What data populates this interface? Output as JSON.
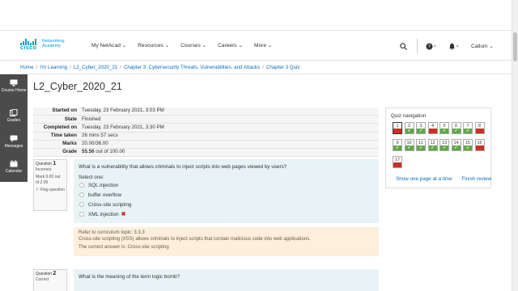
{
  "header": {
    "logo_top": "cisco",
    "logo_right": "Networking Academy",
    "nav": [
      "My NetAcad",
      "Resources",
      "Courses",
      "Careers",
      "More"
    ],
    "user": "Callum"
  },
  "breadcrumb": [
    "Home",
    "I'm Learning",
    "L2_Cyber_2020_21",
    "Chapter 3: Cybersecurity Threats, Vulnerabilities, and Attacks",
    "Chapter 3 Quiz"
  ],
  "sidebar": [
    {
      "label": "Course Home",
      "icon": "monitor-icon"
    },
    {
      "label": "Grades",
      "icon": "grades-icon"
    },
    {
      "label": "Messages",
      "icon": "chat-icon"
    },
    {
      "label": "Calendar",
      "icon": "calendar-icon"
    }
  ],
  "page_title": "L2_Cyber_2020_21",
  "summary": [
    {
      "key": "Started on",
      "value": "Tuesday, 23 February 2021, 3:03 PM"
    },
    {
      "key": "State",
      "value": "Finished"
    },
    {
      "key": "Completed on",
      "value": "Tuesday, 23 February 2021, 3:30 PM"
    },
    {
      "key": "Time taken",
      "value": "26 mins 57 secs"
    },
    {
      "key": "Marks",
      "value": "20.00/36.00"
    },
    {
      "key": "Grade",
      "value_bold": "55.56",
      "value_rest": "out of 100.00"
    }
  ],
  "q1": {
    "label": "Question",
    "number": "1",
    "state": "Incorrect",
    "mark": "Mark 0.00 out of 2.00",
    "flag": "Flag question",
    "text": "What is a vulnerability that allows criminals to inject scripts into web pages viewed by users?",
    "select_prompt": "Select one:",
    "options": [
      "SQL injection",
      "buffer overflow",
      "Cross-site scripting",
      "XML injection"
    ],
    "feedback": [
      "Refer to curriculum topic: 3.3.3",
      "Cross-site scripting (XSS) allows criminals to inject scripts that contain malicious code into web applications.",
      "The correct answer is: Cross-site scripting"
    ]
  },
  "q2": {
    "label": "Question",
    "number": "2",
    "state": "Correct",
    "text": "What is the meaning of the term logic bomb?"
  },
  "quiz_nav": {
    "title": "Quiz navigation",
    "items": [
      {
        "n": "1",
        "ok": false
      },
      {
        "n": "2",
        "ok": true
      },
      {
        "n": "3",
        "ok": true
      },
      {
        "n": "4",
        "ok": false
      },
      {
        "n": "5",
        "ok": true
      },
      {
        "n": "6",
        "ok": true
      },
      {
        "n": "7",
        "ok": true
      },
      {
        "n": "8",
        "ok": false
      },
      {
        "n": "9",
        "ok": true
      },
      {
        "n": "10",
        "ok": true
      },
      {
        "n": "11",
        "ok": true
      },
      {
        "n": "12",
        "ok": true
      },
      {
        "n": "13",
        "ok": true
      },
      {
        "n": "14",
        "ok": true
      },
      {
        "n": "15",
        "ok": true
      },
      {
        "n": "16",
        "ok": false
      },
      {
        "n": "17",
        "ok": false
      }
    ],
    "show_one_page": "Show one page at a time",
    "finish_review": "Finish review"
  },
  "colors": {
    "incorrect": "#ca3120",
    "correct": "#5fa846",
    "link": "#0a6ebd",
    "sidebar": "#4b4b4b",
    "question_bg": "#e7f3f5",
    "feedback_bg": "#fcefdc"
  }
}
